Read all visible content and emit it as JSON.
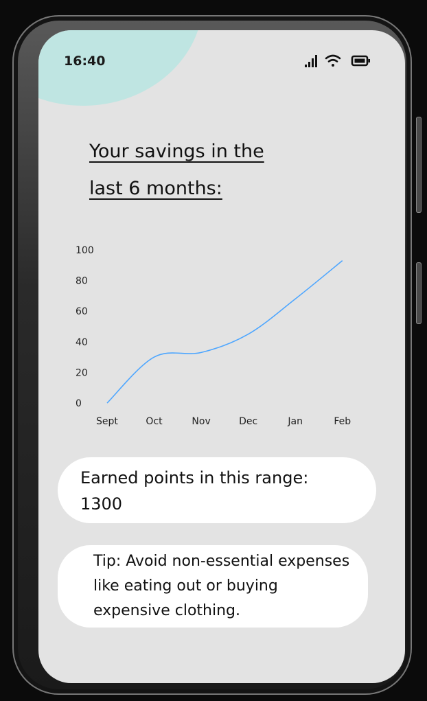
{
  "status_bar": {
    "time": "16:40",
    "icons": [
      "signal-icon",
      "wifi-icon",
      "battery-icon"
    ]
  },
  "title": {
    "line1": "Your savings in the",
    "line2": "last 6 months:"
  },
  "chart_data": {
    "type": "line",
    "categories": [
      "Sept",
      "Oct",
      "Nov",
      "Dec",
      "Jan",
      "Feb"
    ],
    "series": [
      {
        "values": [
          0,
          30,
          33,
          45,
          68,
          93
        ],
        "color": "#4da6ff"
      }
    ],
    "yticks": [
      "0",
      "20",
      "40",
      "60",
      "80",
      "100"
    ],
    "ylim": [
      0,
      100
    ],
    "grid": false
  },
  "points_card": {
    "label": "Earned points in this range:",
    "value": "1300"
  },
  "tip_card": {
    "text": "Tip: Avoid non-essential expenses like eating out or buying expensive clothing."
  },
  "colors": {
    "screen_bg": "#e3e3e3",
    "accent_blob": "#bfe5e2",
    "line": "#4da6ff",
    "card_bg": "#ffffff"
  }
}
